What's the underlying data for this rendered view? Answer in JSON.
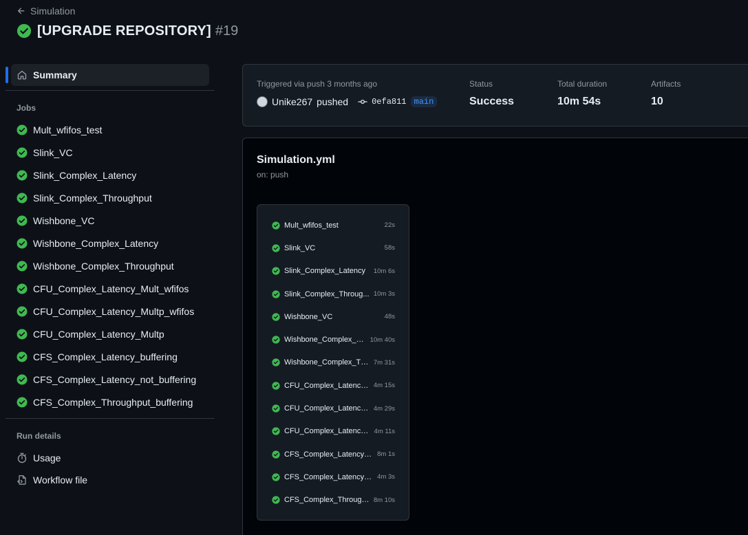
{
  "header": {
    "back_label": "Simulation",
    "title": "[UPGRADE REPOSITORY]",
    "run_number": "#19"
  },
  "sidebar": {
    "summary_label": "Summary",
    "jobs_heading": "Jobs",
    "jobs": [
      {
        "name": "Mult_wfifos_test"
      },
      {
        "name": "Slink_VC"
      },
      {
        "name": "Slink_Complex_Latency"
      },
      {
        "name": "Slink_Complex_Throughput"
      },
      {
        "name": "Wishbone_VC"
      },
      {
        "name": "Wishbone_Complex_Latency"
      },
      {
        "name": "Wishbone_Complex_Throughput"
      },
      {
        "name": "CFU_Complex_Latency_Mult_wfifos"
      },
      {
        "name": "CFU_Complex_Latency_Multp_wfifos"
      },
      {
        "name": "CFU_Complex_Latency_Multp"
      },
      {
        "name": "CFS_Complex_Latency_buffering"
      },
      {
        "name": "CFS_Complex_Latency_not_buffering"
      },
      {
        "name": "CFS_Complex_Throughput_buffering"
      }
    ],
    "run_details_heading": "Run details",
    "usage_label": "Usage",
    "workflow_file_label": "Workflow file"
  },
  "summary_card": {
    "trigger_text": "Triggered via push 3 months ago",
    "actor": "Unike267",
    "action": "pushed",
    "commit_sha": "0efa811",
    "branch": "main",
    "status_label": "Status",
    "status_value": "Success",
    "duration_label": "Total duration",
    "duration_value": "10m 54s",
    "artifacts_label": "Artifacts",
    "artifacts_value": "10"
  },
  "workflow": {
    "file_name": "Simulation.yml",
    "trigger": "on: push",
    "graph_jobs": [
      {
        "name": "Mult_wfifos_test",
        "duration": "22s"
      },
      {
        "name": "Slink_VC",
        "duration": "58s"
      },
      {
        "name": "Slink_Complex_Latency",
        "duration": "10m 6s"
      },
      {
        "name": "Slink_Complex_Throug...",
        "duration": "10m 3s"
      },
      {
        "name": "Wishbone_VC",
        "duration": "48s"
      },
      {
        "name": "Wishbone_Complex_L...",
        "duration": "10m 40s"
      },
      {
        "name": "Wishbone_Complex_Th...",
        "duration": "7m 31s"
      },
      {
        "name": "CFU_Complex_Latency...",
        "duration": "4m 15s"
      },
      {
        "name": "CFU_Complex_Latency...",
        "duration": "4m 29s"
      },
      {
        "name": "CFU_Complex_Latency...",
        "duration": "4m 11s"
      },
      {
        "name": "CFS_Complex_Latency_...",
        "duration": "8m 1s"
      },
      {
        "name": "CFS_Complex_Latency_...",
        "duration": "4m 3s"
      },
      {
        "name": "CFS_Complex_Through...",
        "duration": "8m 10s"
      }
    ]
  },
  "colors": {
    "background": "#0d1117",
    "success_green": "#3fb950",
    "accent_blue": "#1f6feb",
    "muted_text": "#9198a1"
  },
  "icons": {
    "back": "arrow-left-icon",
    "status": "check-circle-icon",
    "summary": "home-icon",
    "usage": "stopwatch-icon",
    "workflow_file": "file-code-icon",
    "commit": "git-commit-icon"
  }
}
